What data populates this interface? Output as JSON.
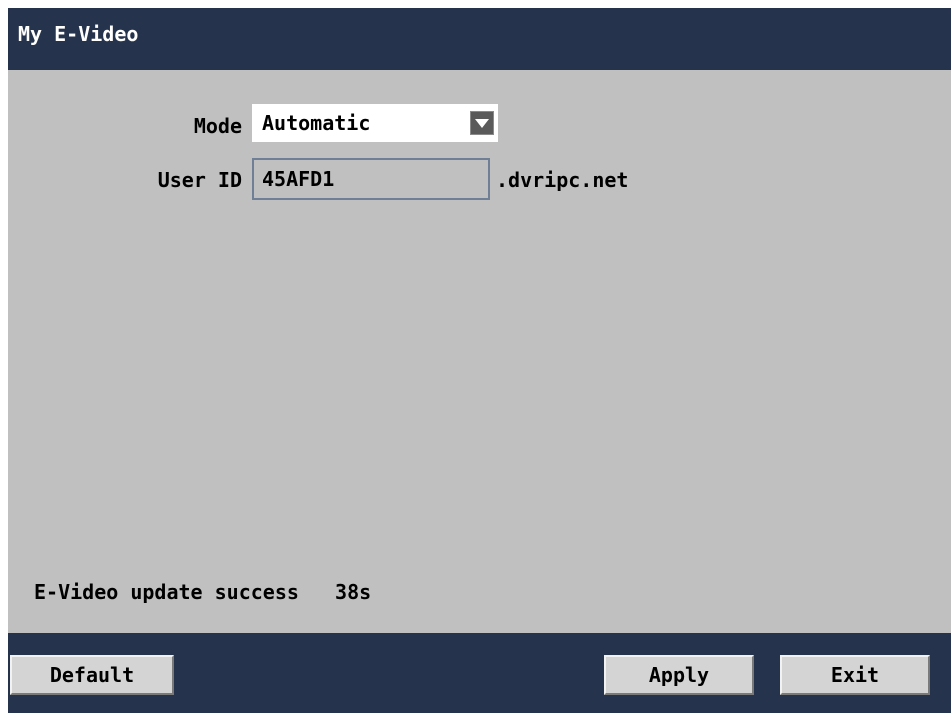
{
  "window": {
    "title": "My E-Video"
  },
  "form": {
    "mode_label": "Mode",
    "mode_value": "Automatic",
    "user_id_label": "User ID",
    "user_id_value": "45AFD1",
    "domain_suffix": ".dvripc.net"
  },
  "status": {
    "message": "E-Video update success   38s"
  },
  "buttons": {
    "default_label": "Default",
    "apply_label": "Apply",
    "exit_label": "Exit"
  },
  "colors": {
    "bar_background": "#26334c",
    "panel_background": "#c0c0c0",
    "button_face": "#d4d4d4"
  },
  "icons": {
    "mode_dropdown": "chevron-down-icon"
  }
}
